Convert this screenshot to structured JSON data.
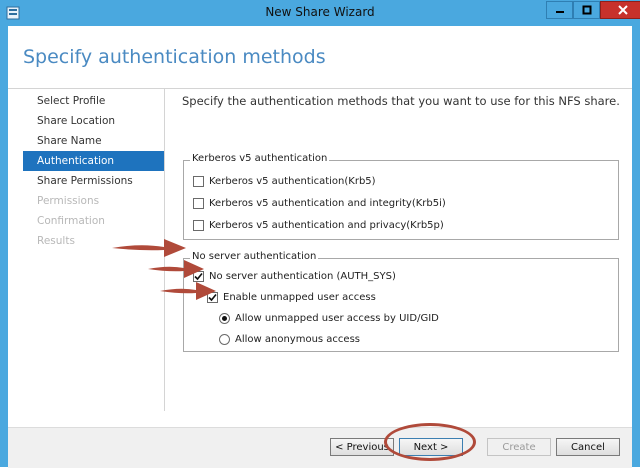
{
  "window": {
    "title": "New Share Wizard"
  },
  "header": {
    "title": "Specify authentication methods"
  },
  "nav": [
    {
      "label": "Select Profile",
      "state": "normal"
    },
    {
      "label": "Share Location",
      "state": "normal"
    },
    {
      "label": "Share Name",
      "state": "normal"
    },
    {
      "label": "Authentication",
      "state": "active"
    },
    {
      "label": "Share Permissions",
      "state": "normal"
    },
    {
      "label": "Permissions",
      "state": "disabled"
    },
    {
      "label": "Confirmation",
      "state": "disabled"
    },
    {
      "label": "Results",
      "state": "disabled"
    }
  ],
  "main": {
    "intro": "Specify the authentication methods that you want to use for this NFS share.",
    "kerberos": {
      "legend": "Kerberos v5 authentication",
      "options": [
        {
          "label": "Kerberos v5 authentication(Krb5)",
          "checked": false
        },
        {
          "label": "Kerberos v5 authentication and integrity(Krb5i)",
          "checked": false
        },
        {
          "label": "Kerberos v5 authentication and privacy(Krb5p)",
          "checked": false
        }
      ]
    },
    "noauth": {
      "legend": "No server authentication",
      "auth_sys": {
        "label": "No server authentication (AUTH_SYS)",
        "checked": true
      },
      "unmapped": {
        "label": "Enable unmapped user access",
        "checked": true
      },
      "radio_uid": {
        "label": "Allow unmapped user access by UID/GID",
        "selected": true
      },
      "radio_anon": {
        "label": "Allow anonymous access",
        "selected": false
      }
    }
  },
  "footer": {
    "previous": "< Previous",
    "next": "Next >",
    "create": "Create",
    "cancel": "Cancel"
  },
  "colors": {
    "titlebar": "#4aa8df",
    "accent": "#1e73be",
    "heading": "#4a8ac2",
    "annotation": "#b04a3a"
  }
}
